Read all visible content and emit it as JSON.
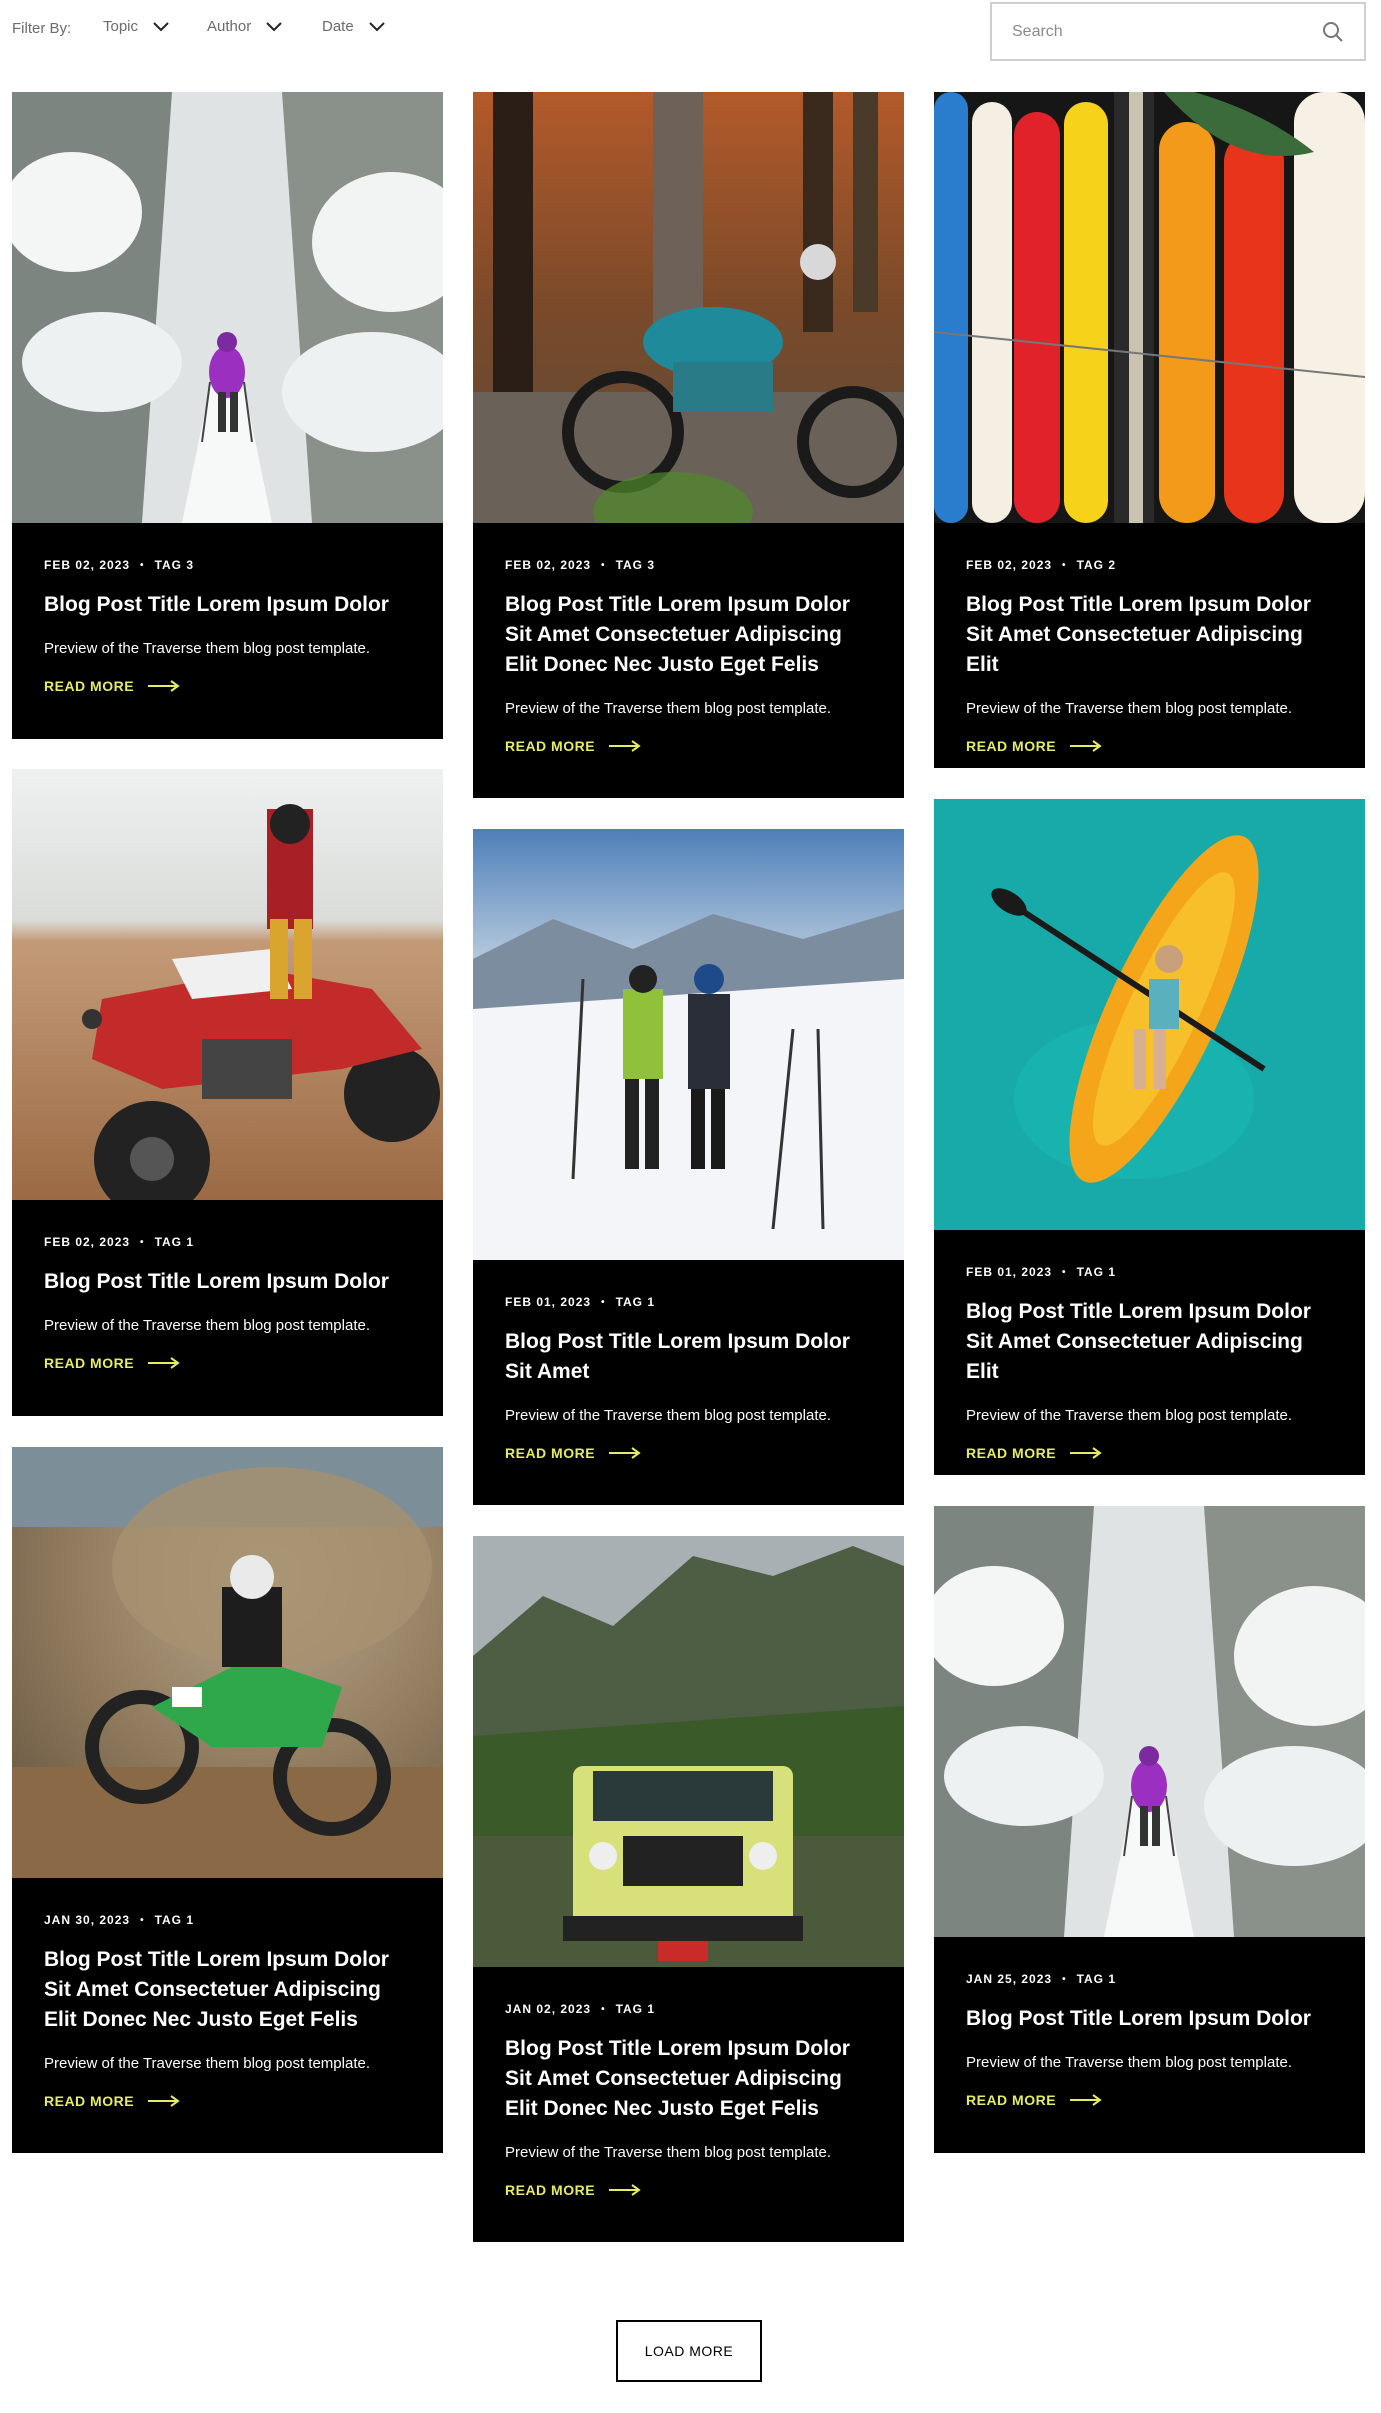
{
  "filters": {
    "label": "Filter By:",
    "options": [
      "Topic",
      "Author",
      "Date"
    ]
  },
  "search": {
    "placeholder": "Search"
  },
  "accent_color": "#e5ec62",
  "read_more_label": "READ MORE",
  "load_more_label": "LOAD MORE",
  "posts": [
    {
      "date": "FEB 02, 2023",
      "tag": "TAG 3",
      "title": "Blog Post Title Lorem Ipsum Dolor",
      "preview": "Preview of the Traverse them blog post template.",
      "image": "snowy-forest-hiker"
    },
    {
      "date": "FEB 02, 2023",
      "tag": "TAG 3",
      "title": "Blog Post Title Lorem Ipsum Dolor Sit Amet Consectetuer Adipiscing Elit Donec Nec Justo Eget Felis",
      "preview": "Preview of the Traverse them blog post template.",
      "image": "motorcycle-forest"
    },
    {
      "date": "FEB 02, 2023",
      "tag": "TAG 2",
      "title": "Blog Post Title Lorem Ipsum Dolor Sit Amet Consectetuer Adipiscing Elit",
      "preview": "Preview of the Traverse them blog post template.",
      "image": "surfboards"
    },
    {
      "date": "FEB 02, 2023",
      "tag": "TAG 1",
      "title": "Blog Post Title Lorem Ipsum Dolor",
      "preview": "Preview of the Traverse them blog post template.",
      "image": "atv-desert"
    },
    {
      "date": "FEB 01, 2023",
      "tag": "TAG 1",
      "title": "Blog Post Title Lorem Ipsum Dolor Sit Amet",
      "preview": "Preview of the Traverse them blog post template.",
      "image": "skiers-mountain"
    },
    {
      "date": "FEB 01, 2023",
      "tag": "TAG 1",
      "title": "Blog Post Title Lorem Ipsum Dolor Sit Amet Consectetuer Adipiscing Elit",
      "preview": "Preview of the Traverse them blog post template.",
      "image": "kayak-turquoise"
    },
    {
      "date": "JAN 30, 2023",
      "tag": "TAG 1",
      "title": "Blog Post Title Lorem Ipsum Dolor Sit Amet Consectetuer Adipiscing Elit Donec Nec Justo Eget Felis",
      "preview": "Preview of the Traverse them blog post template.",
      "image": "dirt-bike"
    },
    {
      "date": "JAN 02, 2023",
      "tag": "TAG 1",
      "title": "Blog Post Title Lorem Ipsum Dolor Sit Amet Consectetuer Adipiscing Elit Donec Nec Justo Eget Felis",
      "preview": "Preview of the Traverse them blog post template.",
      "image": "jeep-mountains"
    },
    {
      "date": "JAN 25, 2023",
      "tag": "TAG 1",
      "title": "Blog Post Title Lorem Ipsum Dolor",
      "preview": "Preview of the Traverse them blog post template.",
      "image": "snowy-forest-hiker"
    }
  ]
}
